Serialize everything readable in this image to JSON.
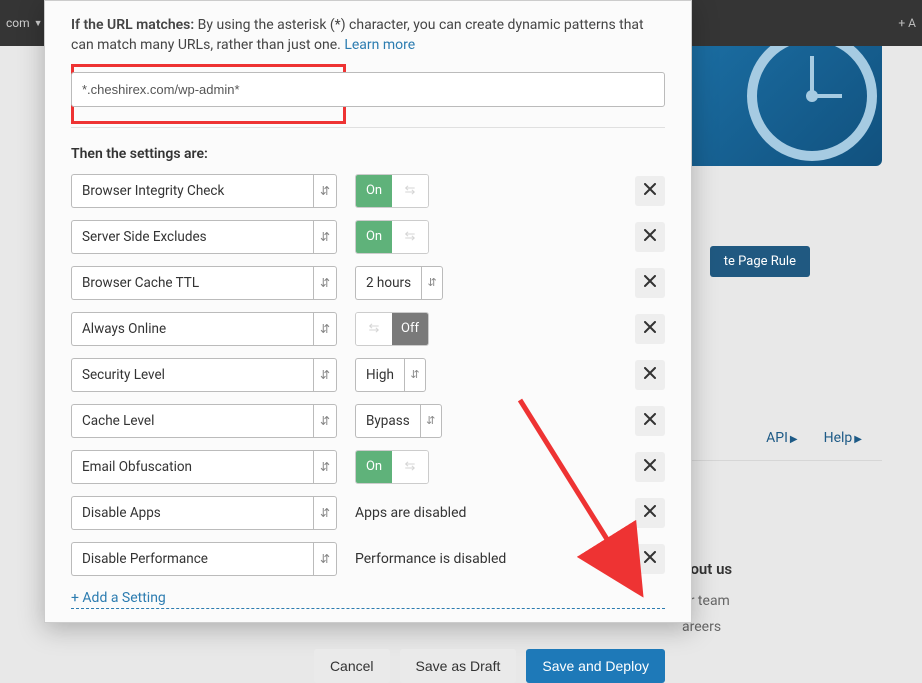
{
  "bg": {
    "topbar_left": "com",
    "topbar_right": "+ A",
    "create_btn": "te Page Rule",
    "api": "API",
    "help": "Help",
    "about_h": "bout us",
    "about_team": "ur team",
    "about_careers": "areers"
  },
  "desc": {
    "label": "If the URL matches:",
    "text": " By using the asterisk (*) character, you can create dynamic patterns that can match many URLs, rather than just one. ",
    "learn_more": "Learn more"
  },
  "url_value": "*.cheshirex.com/wp-admin*",
  "then_label": "Then the settings are:",
  "settings": [
    {
      "name": "Browser Integrity Check",
      "type": "toggle",
      "on": true
    },
    {
      "name": "Server Side Excludes",
      "type": "toggle",
      "on": true
    },
    {
      "name": "Browser Cache TTL",
      "type": "select",
      "value": "2 hours"
    },
    {
      "name": "Always Online",
      "type": "toggle",
      "on": false
    },
    {
      "name": "Security Level",
      "type": "select",
      "value": "High"
    },
    {
      "name": "Cache Level",
      "type": "select",
      "value": "Bypass"
    },
    {
      "name": "Email Obfuscation",
      "type": "toggle",
      "on": true
    },
    {
      "name": "Disable Apps",
      "type": "text",
      "value": "Apps are disabled"
    },
    {
      "name": "Disable Performance",
      "type": "text",
      "value": "Performance is disabled"
    }
  ],
  "add_setting": "+ Add a Setting",
  "toggle_labels": {
    "on": "On",
    "off": "Off"
  },
  "footer": {
    "cancel": "Cancel",
    "save_draft": "Save as Draft",
    "deploy": "Save and Deploy"
  }
}
